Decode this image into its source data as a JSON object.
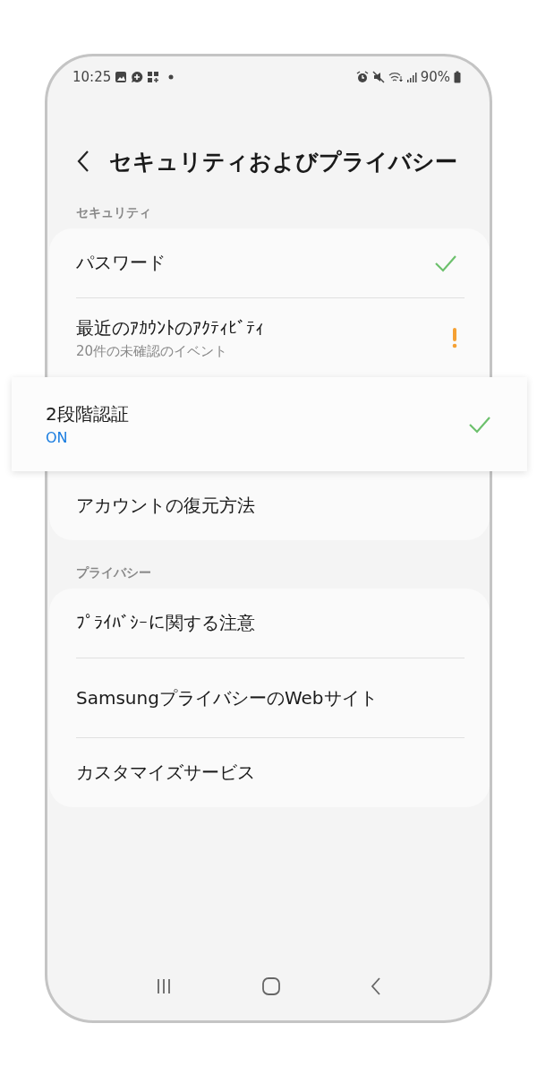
{
  "status_bar": {
    "time": "10:25",
    "battery": "90%"
  },
  "header": {
    "title": "セキュリティおよびプライバシー"
  },
  "sections": [
    {
      "title": "セキュリティ",
      "items": [
        {
          "label": "パスワード",
          "kind": "checked",
          "highlighted": false
        },
        {
          "label": "最近のｱｶｳﾝﾄのｱｸﾃｨﾋﾞﾃｨ",
          "subtitle": "20件の未確認のイベント",
          "kind": "warning",
          "highlighted": false
        },
        {
          "label": "2段階認証",
          "value": "ON",
          "kind": "checked",
          "highlighted": true
        },
        {
          "label": "アカウントの復元方法",
          "kind": "plain",
          "highlighted": false
        }
      ]
    },
    {
      "title": "プライバシー",
      "items": [
        {
          "label": "ﾌﾟﾗｲﾊﾞｼｰに関する注意",
          "kind": "plain",
          "highlighted": false
        },
        {
          "label": "SamsungプライバシーのWebサイト",
          "kind": "plain",
          "highlighted": false
        },
        {
          "label": "カスタマイズサービス",
          "kind": "plain",
          "highlighted": false
        }
      ]
    }
  ]
}
